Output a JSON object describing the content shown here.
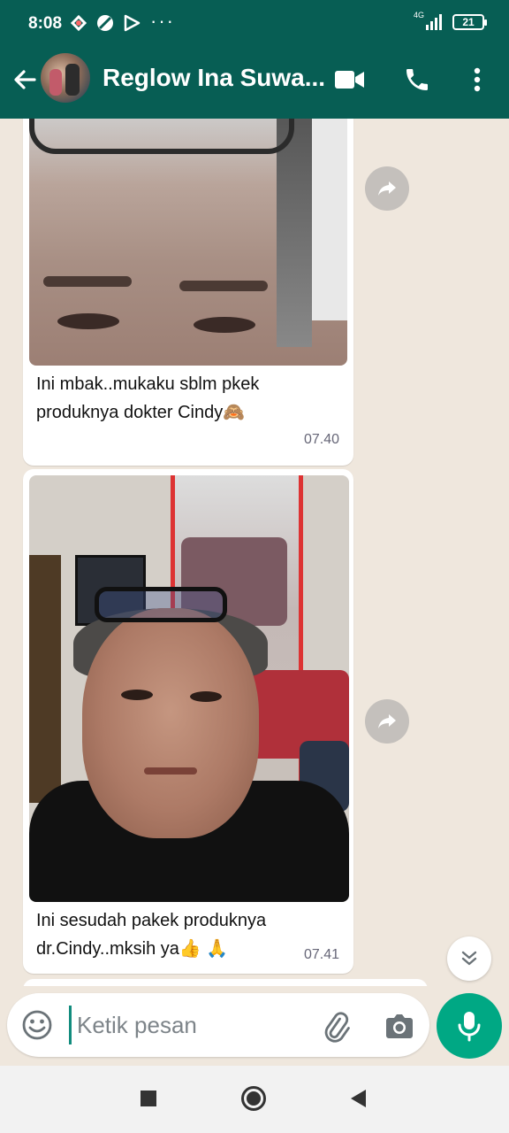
{
  "status_bar": {
    "time": "8:08",
    "dots": "···",
    "network": "4G",
    "battery": "21"
  },
  "header": {
    "contact_name": "Reglow Ina Suwa...",
    "icons": [
      "back-arrow-icon",
      "video-call-icon",
      "phone-icon",
      "more-vert-icon"
    ]
  },
  "messages": [
    {
      "type": "image",
      "caption_line1": "Ini mbak..mukaku sblm pkek",
      "caption_line2": "produknya dokter Cindy🙈",
      "time": "07.40"
    },
    {
      "type": "image",
      "caption_line1": "Ini sesudah pakek produknya",
      "caption_line2": "dr.Cindy..mksih ya👍 🙏",
      "time": "07.41"
    }
  ],
  "composer": {
    "placeholder": "Ketik pesan"
  },
  "colors": {
    "header": "#075e54",
    "chat_bg": "#efe7dd",
    "accent": "#00a884"
  }
}
